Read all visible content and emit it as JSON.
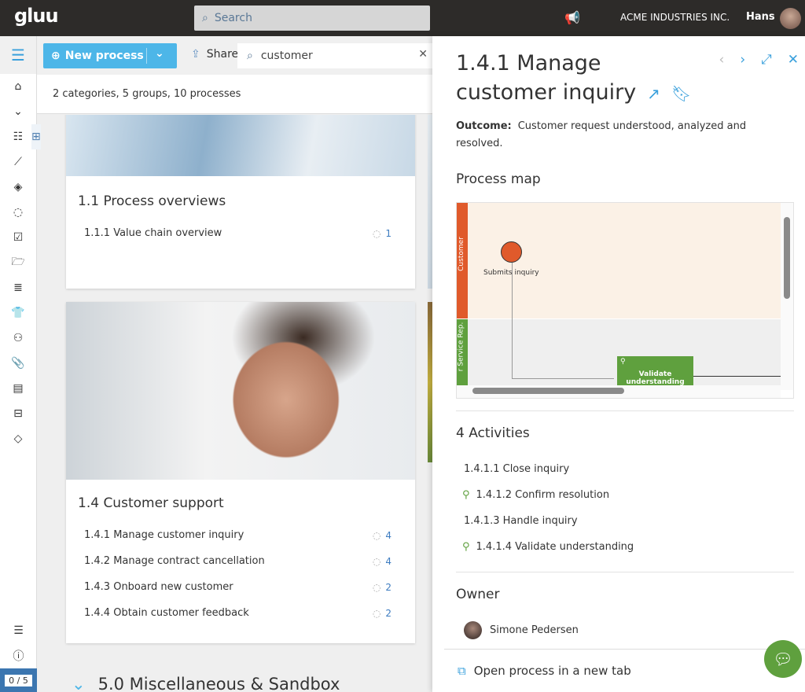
{
  "topbar": {
    "logo": "gluu",
    "search_placeholder": "Search",
    "company": "ACME INDUSTRIES INC.",
    "user": "Hans"
  },
  "sidebar": {
    "icons": [
      "home-icon",
      "chevron-down-icon",
      "grid-icon",
      "list-icon",
      "flow-icon",
      "shapes-icon",
      "cycle-icon",
      "checkbox-icon",
      "folder-icon",
      "database-icon",
      "shirt-icon",
      "people-icon",
      "paperclip-icon",
      "document-icon",
      "widgets-icon",
      "tag-icon"
    ],
    "counter": "0 / 5"
  },
  "toolbar": {
    "new_process": "New process",
    "share": "Share",
    "search_value": "customer"
  },
  "summary": "2 categories, 5 groups, 10 processes",
  "cards": [
    {
      "title": "1.1 Process overviews",
      "items": [
        {
          "label": "1.1.1 Value chain overview",
          "count": "1"
        }
      ]
    },
    {
      "title": "1.4 Customer support",
      "items": [
        {
          "label": "1.4.1 Manage customer inquiry",
          "count": "4"
        },
        {
          "label": "1.4.2 Manage contract cancellation",
          "count": "4"
        },
        {
          "label": "1.4.3 Onboard new customer",
          "count": "2"
        },
        {
          "label": "1.4.4 Obtain customer feedback",
          "count": "2"
        }
      ]
    }
  ],
  "category": "5.0 Miscellaneous & Sandbox",
  "panel": {
    "title": "1.4.1 Manage customer inquiry",
    "outcome_label": "Outcome:",
    "outcome": "Customer request understood, analyzed and resolved.",
    "process_map_heading": "Process map",
    "map": {
      "lane1": "Customer",
      "lane2": "r Service Rep.",
      "event": "Submits inquiry",
      "task": "Validate understanding",
      "lane1_color": "#e05a2b",
      "lane2_color": "#5fa03e"
    },
    "activities_heading": "4 Activities",
    "activities": [
      {
        "label": "1.4.1.1 Close inquiry",
        "icon": ""
      },
      {
        "label": "1.4.1.2 Confirm resolution",
        "icon": "user-task-icon"
      },
      {
        "label": "1.4.1.3 Handle inquiry",
        "icon": ""
      },
      {
        "label": "1.4.1.4 Validate understanding",
        "icon": "user-task-icon"
      }
    ],
    "owner_heading": "Owner",
    "owner": "Simone Pedersen",
    "open_tab": "Open process in a new tab"
  },
  "colors": {
    "accent": "#4db6e8",
    "topbar": "#2d2b29",
    "green": "#5fa03e"
  }
}
